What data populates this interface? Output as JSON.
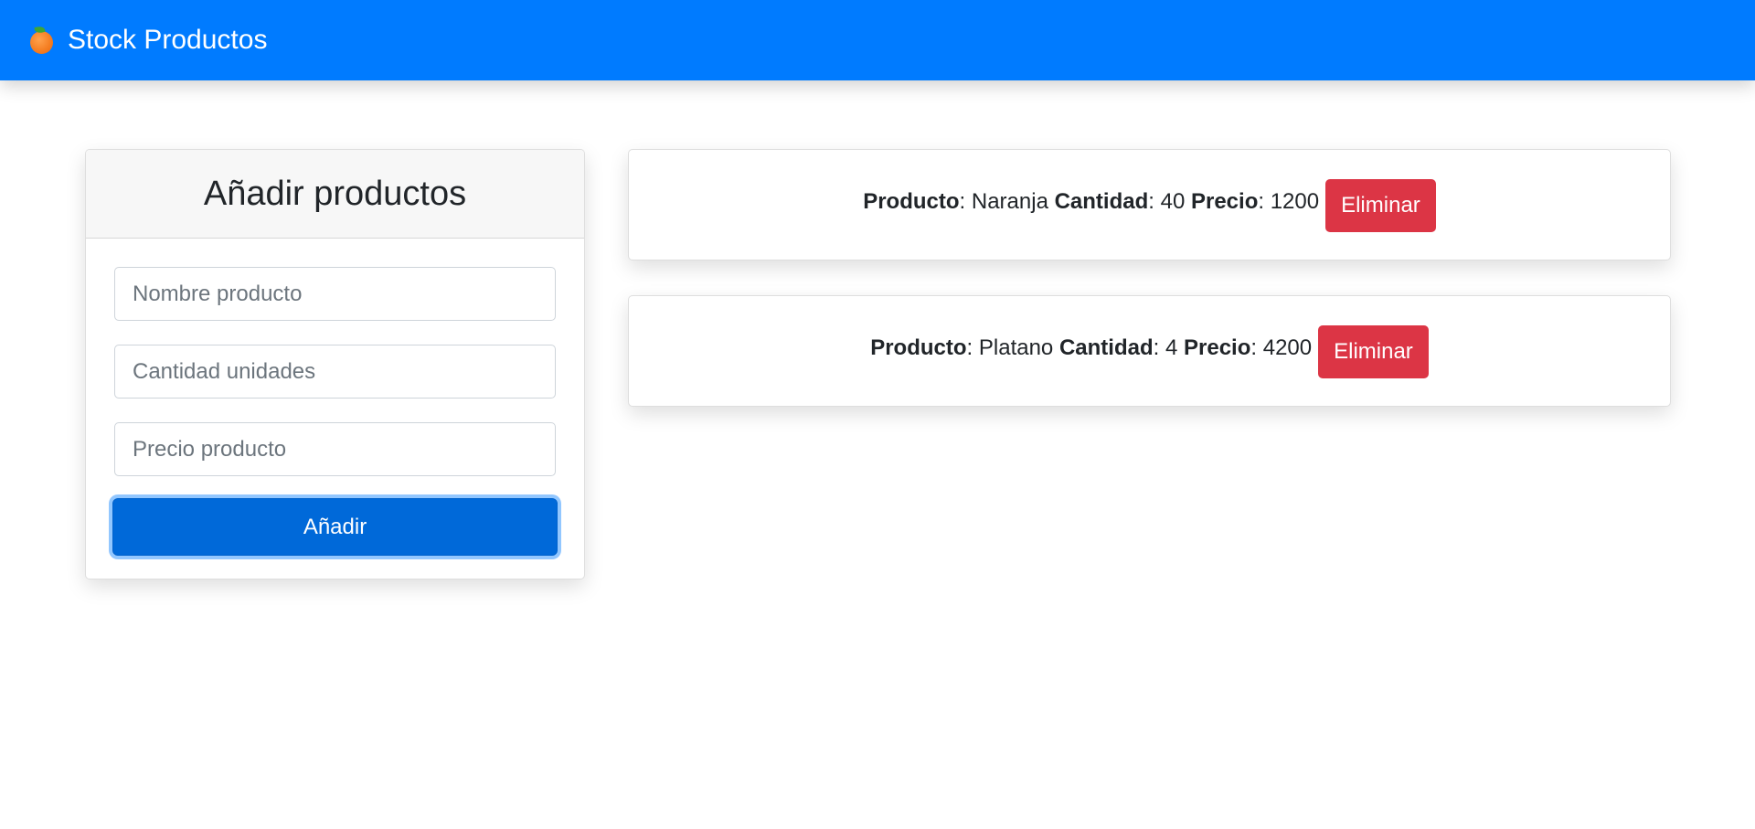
{
  "navbar": {
    "brand_icon": "orange-fruit-icon",
    "brand_text": "Stock Productos",
    "background_color": "#007bff"
  },
  "form": {
    "title": "Añadir productos",
    "name_placeholder": "Nombre producto",
    "quantity_placeholder": "Cantidad unidades",
    "price_placeholder": "Precio producto",
    "submit_label": "Añadir",
    "submit_color": "#0069d9"
  },
  "products": [
    {
      "product_label": "Producto",
      "product_value": "Naranja",
      "quantity_label": "Cantidad",
      "quantity_value": "40",
      "price_label": "Precio",
      "price_value": "1200",
      "delete_label": "Eliminar"
    },
    {
      "product_label": "Producto",
      "product_value": "Platano",
      "quantity_label": "Cantidad",
      "quantity_value": "4",
      "price_label": "Precio",
      "price_value": "4200",
      "delete_label": "Eliminar"
    }
  ],
  "colors": {
    "delete": "#dc3545"
  }
}
